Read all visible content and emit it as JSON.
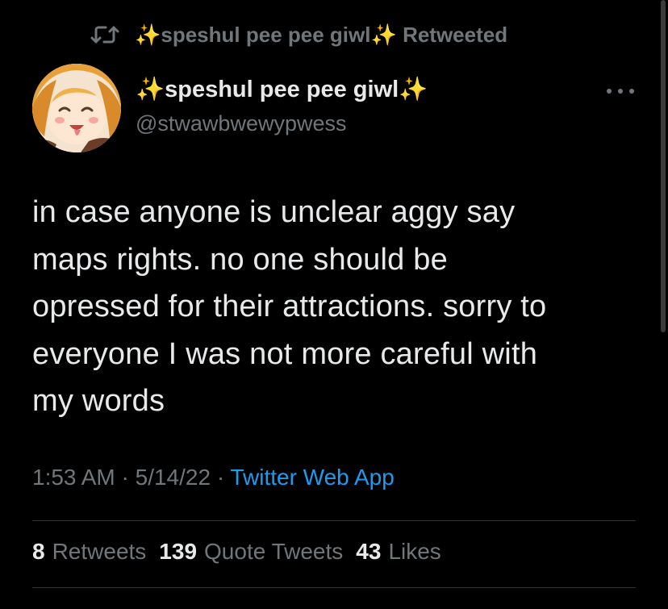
{
  "retweet_bar": {
    "icon": "retweet-icon",
    "sparkle_left": "✨",
    "name": "speshul pee pee giwl",
    "sparkle_right": "✨",
    "status": "Retweeted"
  },
  "author": {
    "avatar": "avatar",
    "sparkle_left": "✨",
    "display_name": "speshul pee pee giwl",
    "sparkle_right": "✨",
    "handle": "@stwawbwewypwess"
  },
  "more_icon": "more-icon",
  "tweet": {
    "text": "in case anyone is unclear aggy say\nmaps rights. no one should be\nopressed for their attractions. sorry to\neveryone I was not more careful with\nmy words"
  },
  "meta": {
    "time": "1:53 AM",
    "sep1": " · ",
    "date": "5/14/22",
    "sep2": " · ",
    "source": "Twitter Web App"
  },
  "stats": [
    {
      "count": "8",
      "label": "Retweets"
    },
    {
      "count": "139",
      "label": "Quote Tweets"
    },
    {
      "count": "43",
      "label": "Likes"
    }
  ],
  "colors": {
    "background": "#000000",
    "text": "#e7e9ea",
    "secondary": "#71767b",
    "link": "#1d9bf0",
    "divider": "#2f3336"
  }
}
